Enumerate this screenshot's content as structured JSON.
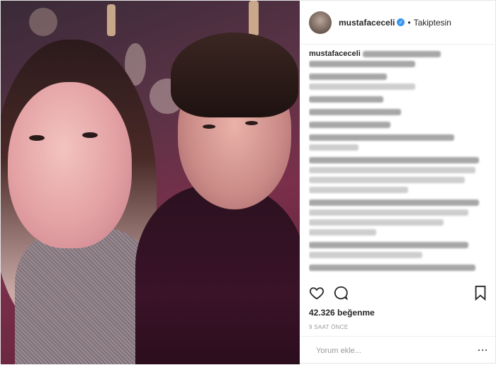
{
  "post": {
    "username": "mustafaceceli",
    "follow_status": "Takiptesin",
    "likes": "42.326 beğenme",
    "time_ago": "9 SAAT ÖNCE",
    "comment_placeholder": "Yorum ekle...",
    "verified_color": "#3897f0"
  },
  "comments": [
    {
      "user": "",
      "lines": [
        110,
        150
      ]
    },
    {
      "user": "",
      "lines": [
        105
      ]
    },
    {
      "user": "",
      "lines": [
        130
      ]
    },
    {
      "user": "",
      "lines": [
        115
      ]
    },
    {
      "user": "",
      "lines": [
        205,
        70
      ]
    },
    {
      "user": "",
      "lines": [
        240,
        235,
        220,
        140
      ]
    },
    {
      "user": "",
      "lines": [
        240,
        225,
        190,
        95
      ]
    },
    {
      "user": "",
      "lines": [
        225,
        160
      ]
    },
    {
      "user": "",
      "lines": [
        235
      ]
    }
  ],
  "icons": [
    "heart-icon",
    "comment-icon",
    "bookmark-icon",
    "more-icon",
    "verified-icon"
  ]
}
